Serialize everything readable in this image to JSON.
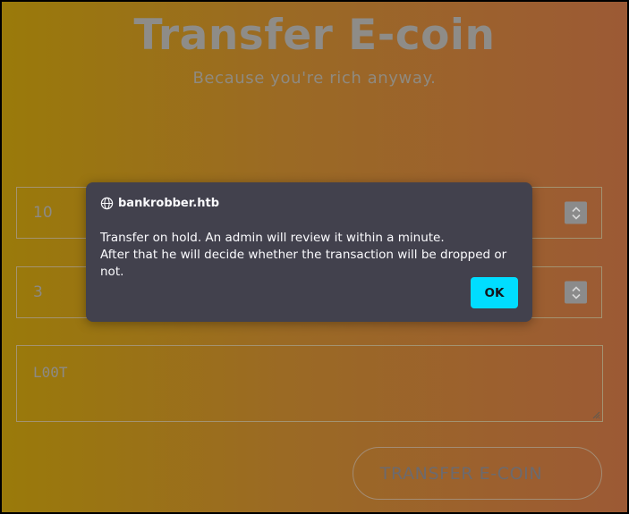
{
  "page": {
    "title": "Transfer E-coin",
    "subtitle": "Because you're rich anyway."
  },
  "form": {
    "amount_value": "10",
    "id_value": "3",
    "comment_value": "L00T",
    "submit_label": "TRANSFER E-COIN"
  },
  "dialog": {
    "host": "bankrobber.htb",
    "message_line1": "Transfer on hold. An admin will review it within a minute.",
    "message_line2": "After that he will decide whether the transaction will be dropped or not.",
    "ok_label": "OK",
    "host_icon": "globe-icon"
  },
  "colors": {
    "accent": "#00ddff",
    "dialog_bg": "#42414d"
  }
}
